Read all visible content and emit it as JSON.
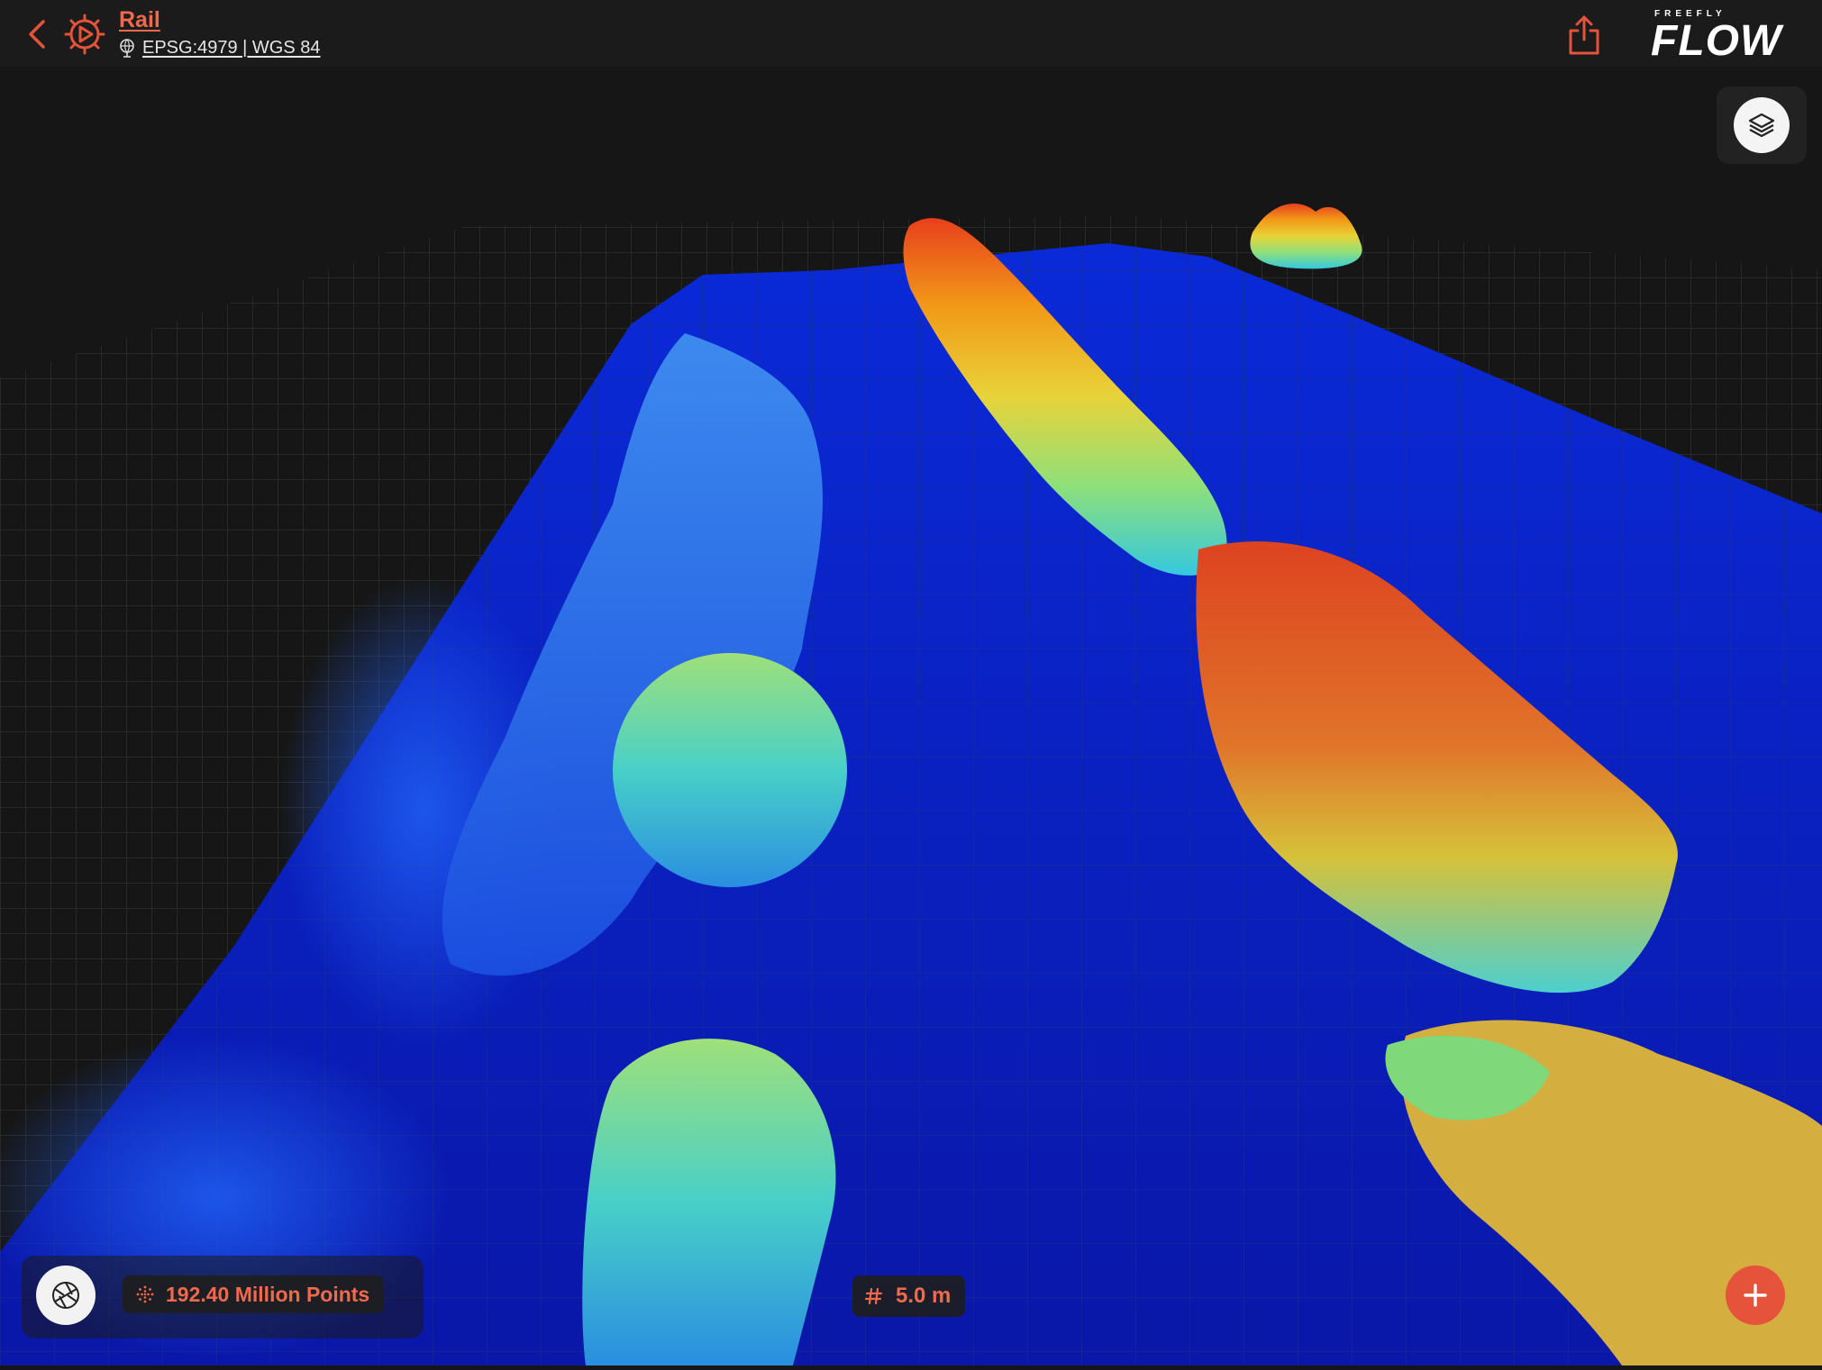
{
  "app": {
    "title": "Rail",
    "crs": "EPSG:4979 | WGS 84",
    "brand_small": "FREEFLY",
    "brand_big": "FLOW"
  },
  "icons": {
    "back": "chevron-left-icon",
    "settings": "cog-play-icon",
    "crs": "globe-pin-icon",
    "share": "share-icon",
    "layers": "layers-icon",
    "shutter": "aperture-icon",
    "points": "point-cloud-icon",
    "grid": "grid-hash-icon",
    "add": "plus-icon"
  },
  "status": {
    "points": "192.40 Million Points",
    "grid_spacing": "5.0 m"
  },
  "colors": {
    "accent": "#e5533a",
    "accent_text": "#ef6a4d",
    "background": "#161616",
    "ground": "#0a22c8"
  }
}
